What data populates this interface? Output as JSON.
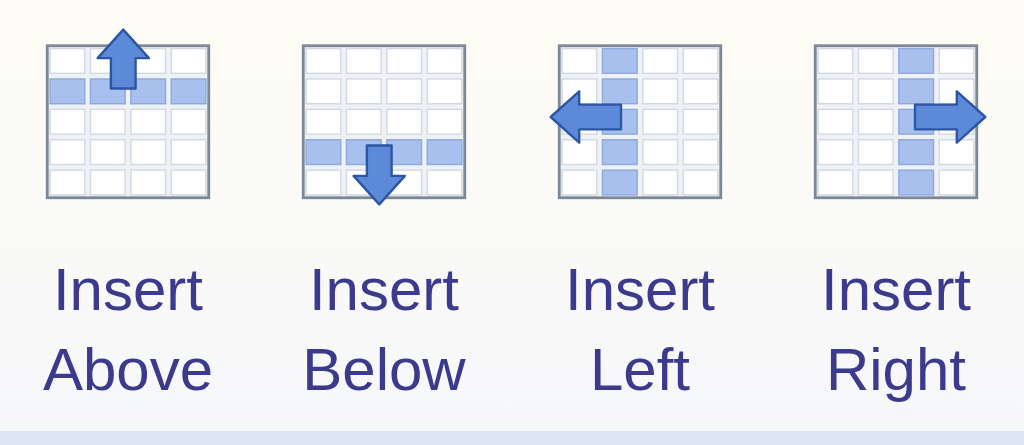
{
  "buttons": [
    {
      "kind": "above",
      "lines": [
        "Insert",
        "Above"
      ]
    },
    {
      "kind": "below",
      "lines": [
        "Insert",
        "Below"
      ]
    },
    {
      "kind": "left",
      "lines": [
        "Insert",
        "Left"
      ]
    },
    {
      "kind": "right",
      "lines": [
        "Insert",
        "Right"
      ]
    }
  ]
}
